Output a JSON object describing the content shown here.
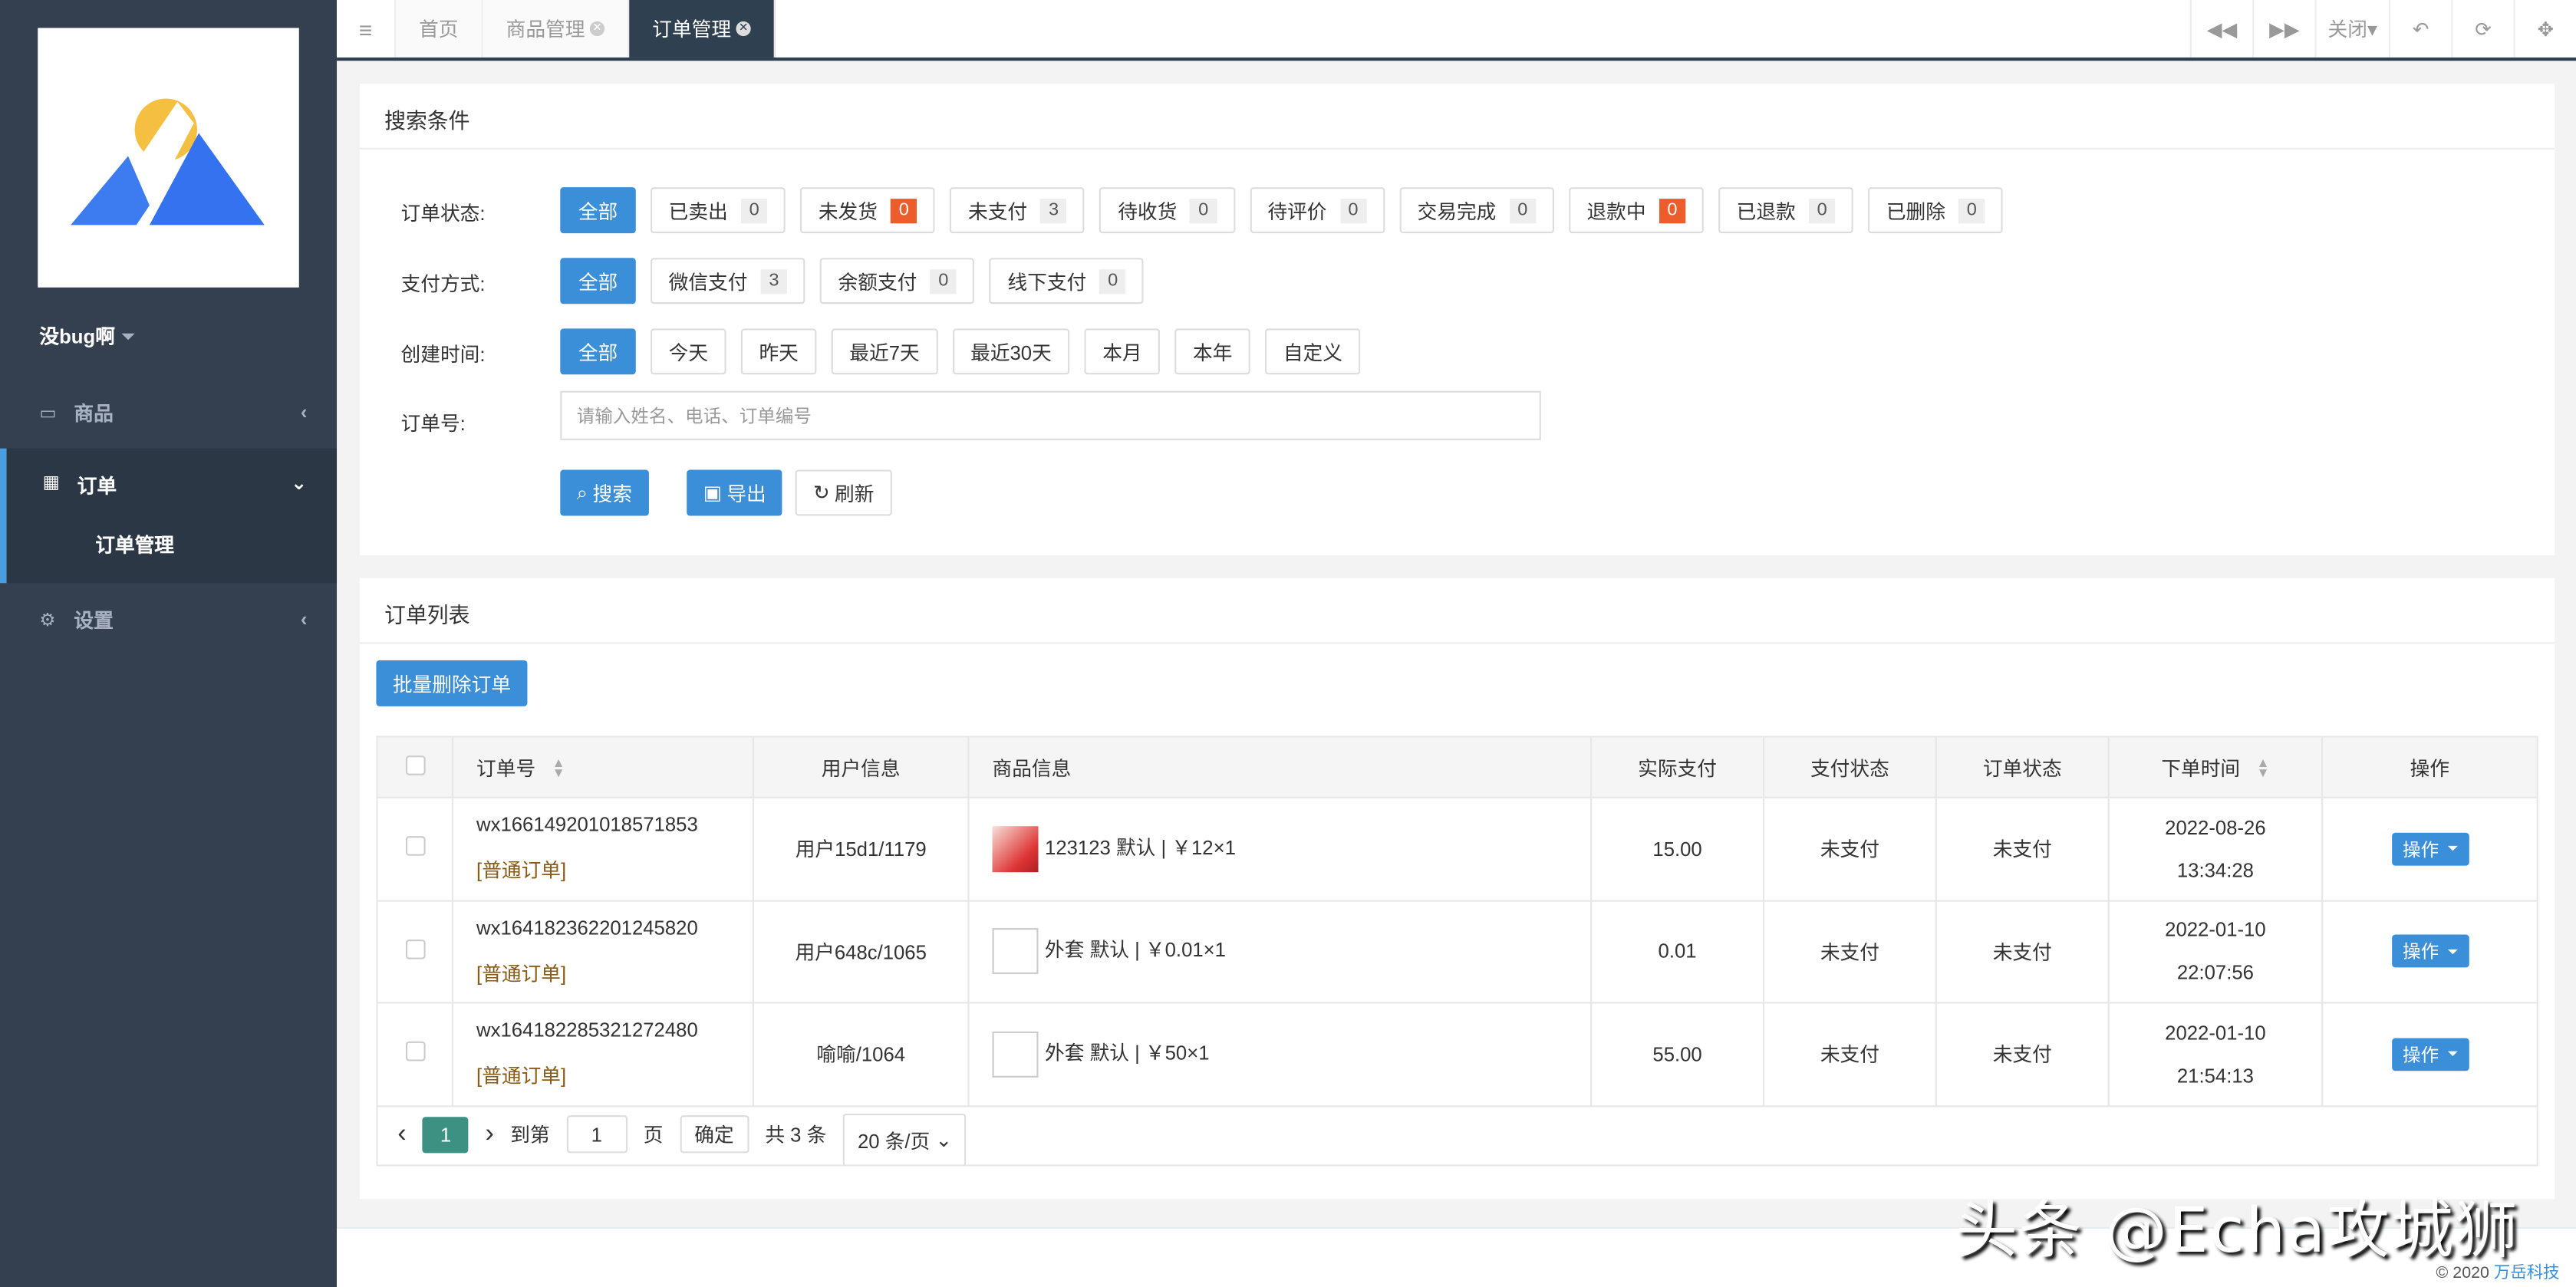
{
  "sidebar": {
    "user": "没bug啊",
    "items": [
      {
        "label": "商品"
      },
      {
        "label": "订单",
        "sub": "订单管理"
      },
      {
        "label": "设置"
      }
    ]
  },
  "tabs": [
    "首页",
    "商品管理",
    "订单管理"
  ],
  "tools": {
    "close": "关闭"
  },
  "search": {
    "title": "搜索条件",
    "status_label": "订单状态:",
    "status": [
      {
        "l": "全部"
      },
      {
        "l": "已卖出",
        "c": "0"
      },
      {
        "l": "未发货",
        "c": "0"
      },
      {
        "l": "未支付",
        "c": "3"
      },
      {
        "l": "待收货",
        "c": "0"
      },
      {
        "l": "待评价",
        "c": "0"
      },
      {
        "l": "交易完成",
        "c": "0"
      },
      {
        "l": "退款中",
        "c": "0"
      },
      {
        "l": "已退款",
        "c": "0"
      },
      {
        "l": "已删除",
        "c": "0"
      }
    ],
    "pay_label": "支付方式:",
    "pay": [
      {
        "l": "全部"
      },
      {
        "l": "微信支付",
        "c": "3"
      },
      {
        "l": "余额支付",
        "c": "0"
      },
      {
        "l": "线下支付",
        "c": "0"
      }
    ],
    "time_label": "创建时间:",
    "time": [
      "全部",
      "今天",
      "昨天",
      "最近7天",
      "最近30天",
      "本月",
      "本年",
      "自定义"
    ],
    "order_label": "订单号:",
    "placeholder": "请输入姓名、电话、订单编号",
    "search_btn": "搜索",
    "export_btn": "导出",
    "refresh_btn": "刷新"
  },
  "list": {
    "title": "订单列表",
    "batch_delete": "批量删除订单",
    "headers": [
      "订单号",
      "用户信息",
      "商品信息",
      "实际支付",
      "支付状态",
      "订单状态",
      "下单时间",
      "操作"
    ],
    "rows": [
      {
        "no": "wx166149201018571853",
        "type": "[普通订单]",
        "user": "用户15d1/1179",
        "goods": "123123 默认 | ￥12×1",
        "paid": "15.00",
        "pay_status": "未支付",
        "status": "未支付",
        "date": "2022-08-26",
        "time": "13:34:28",
        "op": "操作"
      },
      {
        "no": "wx164182362201245820",
        "type": "[普通订单]",
        "user": "用户648c/1065",
        "goods": "外套 默认 | ￥0.01×1",
        "paid": "0.01",
        "pay_status": "未支付",
        "status": "未支付",
        "date": "2022-01-10",
        "time": "22:07:56",
        "op": "操作"
      },
      {
        "no": "wx164182285321272480",
        "type": "[普通订单]",
        "user": "喻喻/1064",
        "goods": "外套 默认 | ￥50×1",
        "paid": "55.00",
        "pay_status": "未支付",
        "status": "未支付",
        "date": "2022-01-10",
        "time": "21:54:13",
        "op": "操作"
      }
    ],
    "pager": {
      "current": "1",
      "goto": "到第",
      "page_value": "1",
      "page": "页",
      "confirm": "确定",
      "total": "共 3 条",
      "size": "20 条/页"
    }
  },
  "footer": {
    "copyright": "© 2020",
    "company": "万岳科技"
  },
  "watermark": "头条 @Echa攻城狮"
}
